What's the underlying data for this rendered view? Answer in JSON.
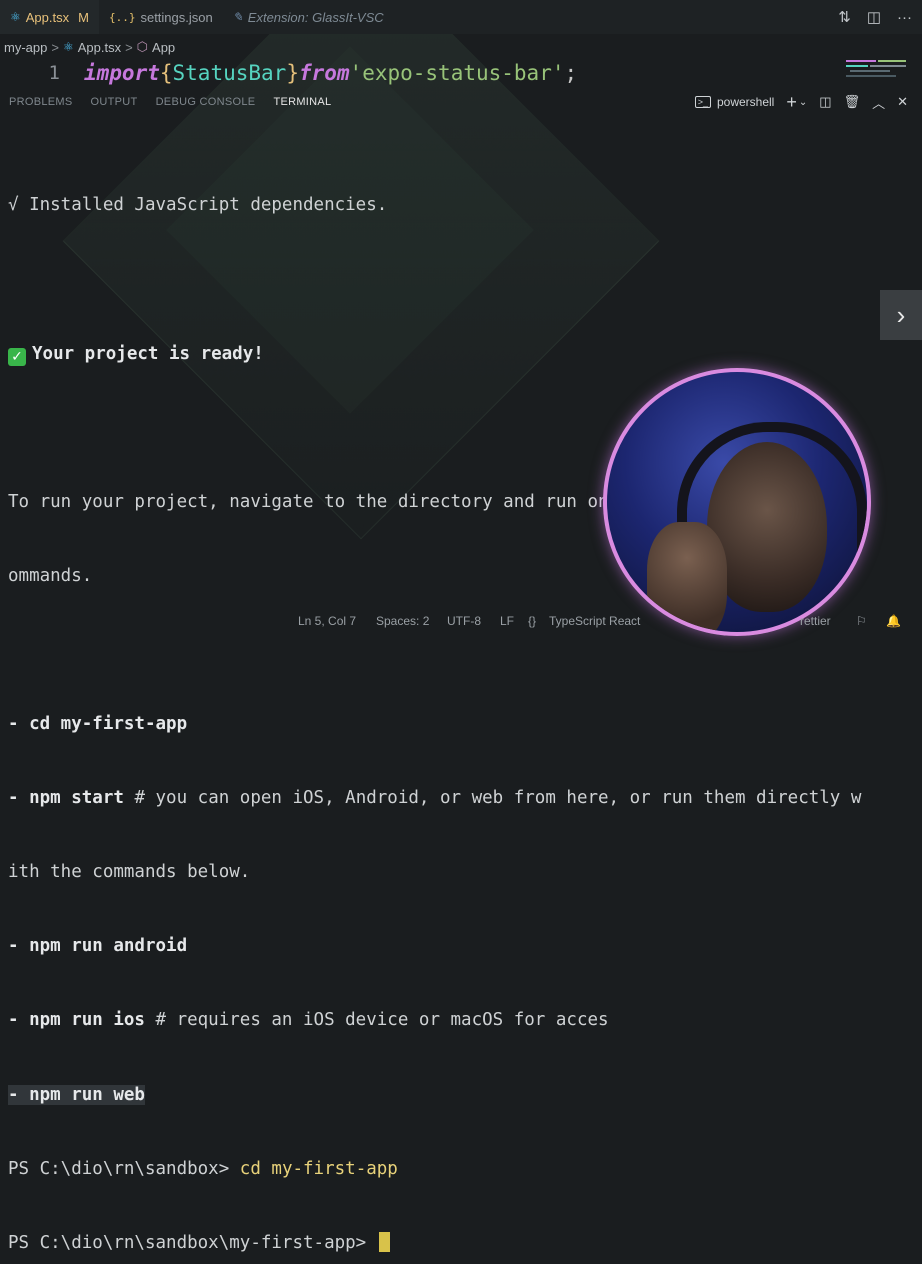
{
  "tabs": [
    {
      "icon": "react-icon",
      "label": "App.tsx",
      "modified": "M",
      "active": true
    },
    {
      "icon": "json-braces-icon",
      "icon_glyph": "{..}",
      "label": "settings.json",
      "active": false
    },
    {
      "icon": "extension-icon",
      "label": "Extension: GlassIt-VSC",
      "active": false
    }
  ],
  "breadcrumb": {
    "folder": "my-app",
    "file": "App.tsx",
    "symbol": "App"
  },
  "editor": {
    "line_number": "1",
    "kw_import": "import",
    "brace_open": "{",
    "identifier": "StatusBar",
    "brace_close": "}",
    "kw_from": "from",
    "string": "'expo-status-bar'",
    "semicolon": ";"
  },
  "panel": {
    "tabs": [
      "PROBLEMS",
      "OUTPUT",
      "DEBUG CONSOLE",
      "TERMINAL"
    ],
    "shell": "powershell"
  },
  "terminal": {
    "installed": "√ Installed JavaScript dependencies.",
    "ready": "Your project is ready!",
    "run_line1": "To run your project, navigate to the directory and run one of the following npm c",
    "run_line2": "ommands.",
    "cd_prefix": "- ",
    "cd_cmd": "cd my-first-app",
    "start_cmd": "- npm start",
    "start_comment": " # you can open iOS, Android, or web from here, or run them directly w",
    "start_wrap": "ith the commands below.",
    "android_cmd": "- npm run android",
    "ios_cmd": "- npm run ios",
    "ios_comment": " # requires an iOS device or macOS for acces",
    "web_cmd": "- npm run web",
    "prompt1": "PS C:\\dio\\rn\\sandbox> ",
    "prompt1_cmd": "cd my-first-app",
    "prompt2": "PS C:\\dio\\rn\\sandbox\\my-first-app> "
  },
  "statusbar": {
    "position": "Ln 5, Col 7",
    "spaces": "Spaces: 2",
    "encoding": "UTF-8",
    "eol": "LF",
    "language": "TypeScript React",
    "formatter": "rettier"
  },
  "colors": {
    "accent_tab": "#e8c17a",
    "keyword": "#c678dd",
    "identifier": "#56d4c0",
    "string": "#98c379",
    "cursor": "#d8c24a",
    "webcam_ring": "#d98be0"
  }
}
